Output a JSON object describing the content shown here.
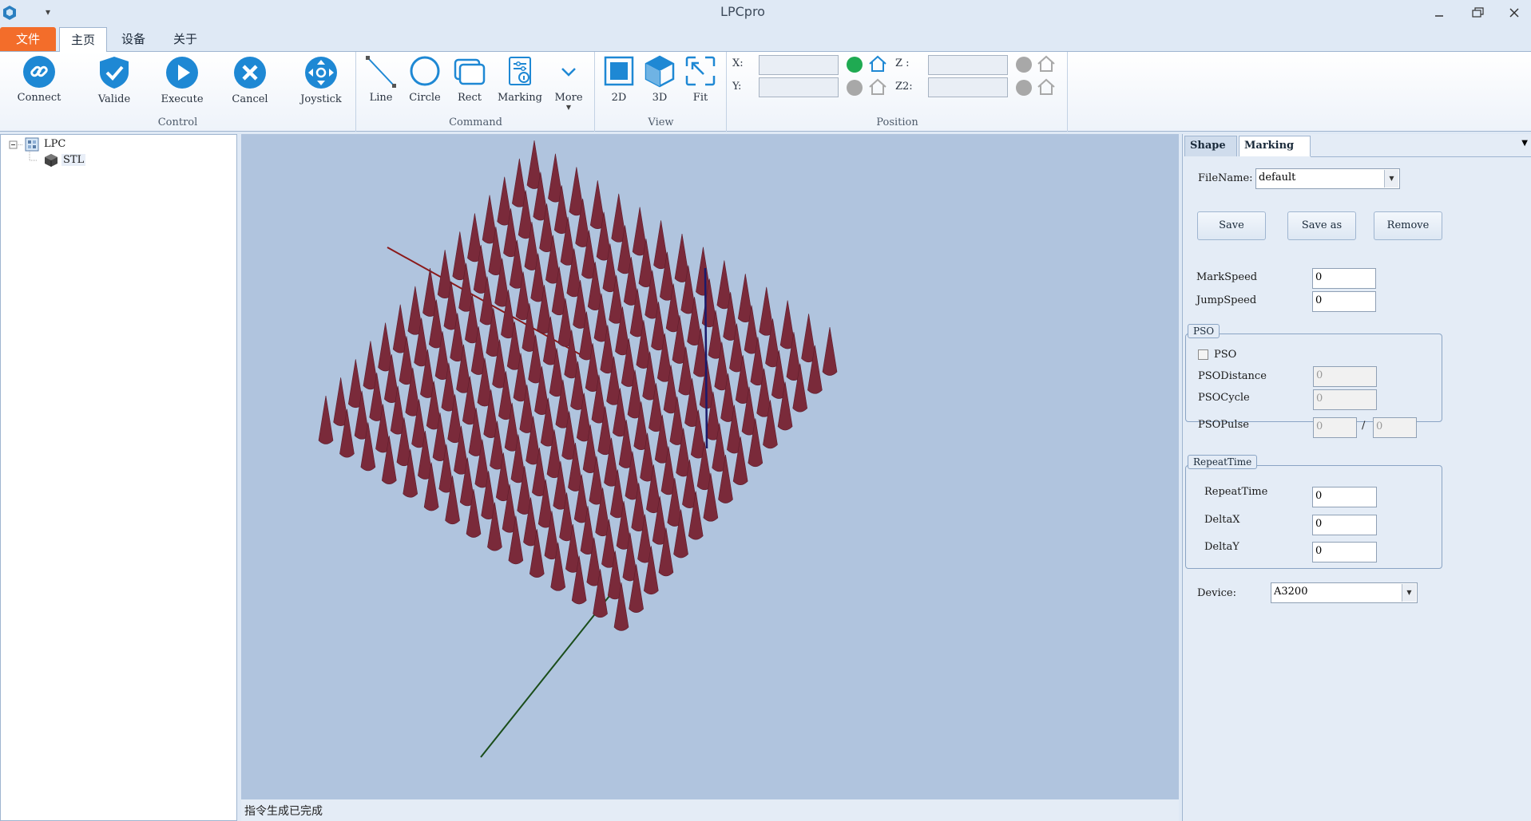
{
  "window": {
    "title": "LPCpro"
  },
  "menu": {
    "file": "文件",
    "home": "主页",
    "device": "设备",
    "about": "关于"
  },
  "ribbon": {
    "control": {
      "label": "Control",
      "connect": "Connect",
      "valide": "Valide",
      "execute": "Execute",
      "cancel": "Cancel",
      "joystick": "Joystick"
    },
    "command": {
      "label": "Command",
      "line": "Line",
      "circle": "Circle",
      "rect": "Rect",
      "marking": "Marking",
      "more": "More"
    },
    "view": {
      "label": "View",
      "btn2d": "2D",
      "btn3d": "3D",
      "fit": "Fit"
    },
    "position": {
      "label": "Position",
      "x_label": "X:",
      "y_label": "Y:",
      "z_label": "Z :",
      "z2_label": "Z2:",
      "x_value": "",
      "y_value": "",
      "z_value": "",
      "z2_value": ""
    }
  },
  "tree": {
    "root": "LPC",
    "child": "STL"
  },
  "status": {
    "text": "指令生成已完成"
  },
  "panel": {
    "tabs": {
      "shape": "Shape",
      "marking": "Marking"
    },
    "filename_label": "FileName:",
    "filename_value": "default",
    "save": "Save",
    "save_as": "Save as",
    "remove": "Remove",
    "markspeed_label": "MarkSpeed",
    "markspeed_value": "0",
    "jumpspeed_label": "JumpSpeed",
    "jumpspeed_value": "0",
    "pso": {
      "title": "PSO",
      "checkbox_label": "PSO",
      "distance_label": "PSODistance",
      "distance_value": "0",
      "cycle_label": "PSOCycle",
      "cycle_value": "0",
      "pulse_label": "PSOPulse",
      "pulse_value_a": "0",
      "pulse_sep": "/",
      "pulse_value_b": "0"
    },
    "repeat": {
      "title": "RepeatTime",
      "repeattime_label": "RepeatTime",
      "repeattime_value": "0",
      "deltax_label": "DeltaX",
      "deltax_value": "0",
      "deltay_label": "DeltaY",
      "deltay_value": "0"
    },
    "device_label": "Device:",
    "device_value": "A3200"
  },
  "colors": {
    "accent": "#1e88d4",
    "file_tab": "#f36d2a",
    "viewport_bg": "#b0c4de",
    "cone": "#7a2a3a",
    "axis_x": "#8b1a1a",
    "axis_y": "#1a4d1a",
    "axis_z": "#1a1a6b",
    "led_on": "#1faa52",
    "led_off": "#a8a8a8"
  },
  "icons": [
    "app-logo-icon",
    "link-icon",
    "shield-check-icon",
    "play-icon",
    "cancel-icon",
    "joystick-icon",
    "line-icon",
    "circle-icon",
    "rect-icon",
    "marking-icon",
    "chevron-down-icon",
    "view-2d-icon",
    "view-3d-icon",
    "fit-icon",
    "home-icon"
  ]
}
